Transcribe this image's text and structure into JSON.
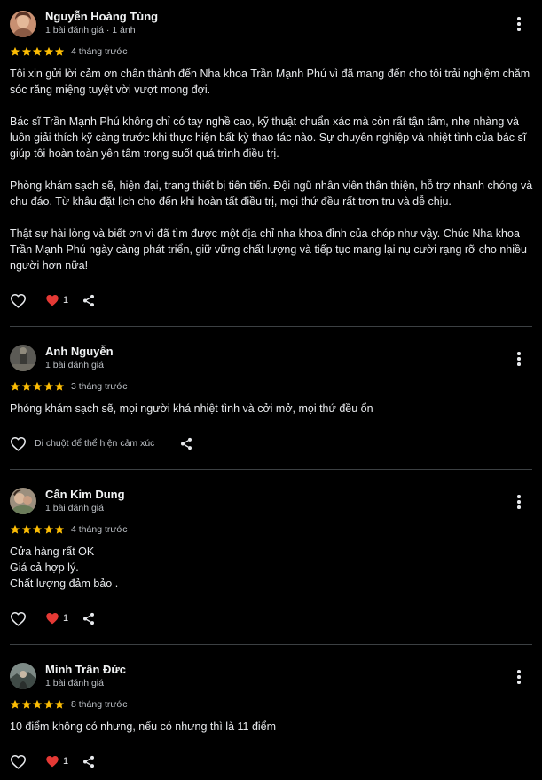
{
  "colors": {
    "star": "#fbbc04",
    "heart": "#e53935",
    "background": "#000000",
    "divider": "#3c4043"
  },
  "icons": {
    "star": "star-icon",
    "like": "thumbs-heart-outline-icon",
    "reaction": "red-heart-icon",
    "share": "share-icon",
    "menu": "more-vert-icon"
  },
  "reviews": [
    {
      "name": "Nguyễn Hoàng Tùng",
      "meta": "1 bài đánh giá · 1 ảnh",
      "rating": 5,
      "date": "4 tháng trước",
      "paragraphs": [
        "Tôi xin gửi lời cảm ơn chân thành đến Nha khoa Trần Mạnh Phú vì đã mang đến cho tôi trải nghiệm chăm sóc răng miệng tuyệt vời vượt mong đợi.",
        "Bác sĩ Trần Mạnh Phú không chỉ có tay nghề cao, kỹ thuật chuẩn xác mà còn rất tận tâm, nhẹ nhàng và luôn giải thích kỹ càng trước khi thực hiện bất kỳ thao tác nào. Sự chuyên nghiệp và nhiệt tình của bác sĩ giúp tôi hoàn toàn yên tâm trong suốt quá trình điều trị.",
        "Phòng khám sạch sẽ, hiện đại, trang thiết bị tiên tiến. Đội ngũ nhân viên thân thiện, hỗ trợ nhanh chóng và chu đáo. Từ khâu đặt lịch cho đến khi hoàn tất điều trị, mọi thứ đều rất trơn tru và dễ chịu.",
        "Thật sự hài lòng và biết ơn vì đã tìm được một địa chỉ nha khoa đỉnh của chóp như vậy. Chúc Nha khoa Trần Mạnh Phú ngày càng phát triển, giữ vững chất lượng và tiếp tục mang lại nụ cười rạng rỡ cho nhiều người hơn nữa!"
      ],
      "heart_count": "1"
    },
    {
      "name": "Anh Nguyễn",
      "meta": "1 bài đánh giá",
      "rating": 5,
      "date": "3 tháng trước",
      "paragraphs": [
        "Phóng khám sạch sẽ, mọi người khá nhiệt tình và cởi mở, mọi thứ đều ổn"
      ],
      "hover_hint": "Di chuột để thể hiện cảm xúc"
    },
    {
      "name": "Cấn Kim Dung",
      "meta": "1 bài đánh giá",
      "rating": 5,
      "date": "4 tháng trước",
      "lines": [
        "Cửa hàng rất OK",
        "Giá cả hợp lý.",
        "Chất lượng đảm bảo ."
      ],
      "heart_count": "1"
    },
    {
      "name": "Minh Trần Đức",
      "meta": "1 bài đánh giá",
      "rating": 5,
      "date": "8 tháng trước",
      "paragraphs": [
        "10 điểm không có nhưng, nếu có nhưng thì là 11 điểm"
      ],
      "heart_count": "1"
    }
  ]
}
